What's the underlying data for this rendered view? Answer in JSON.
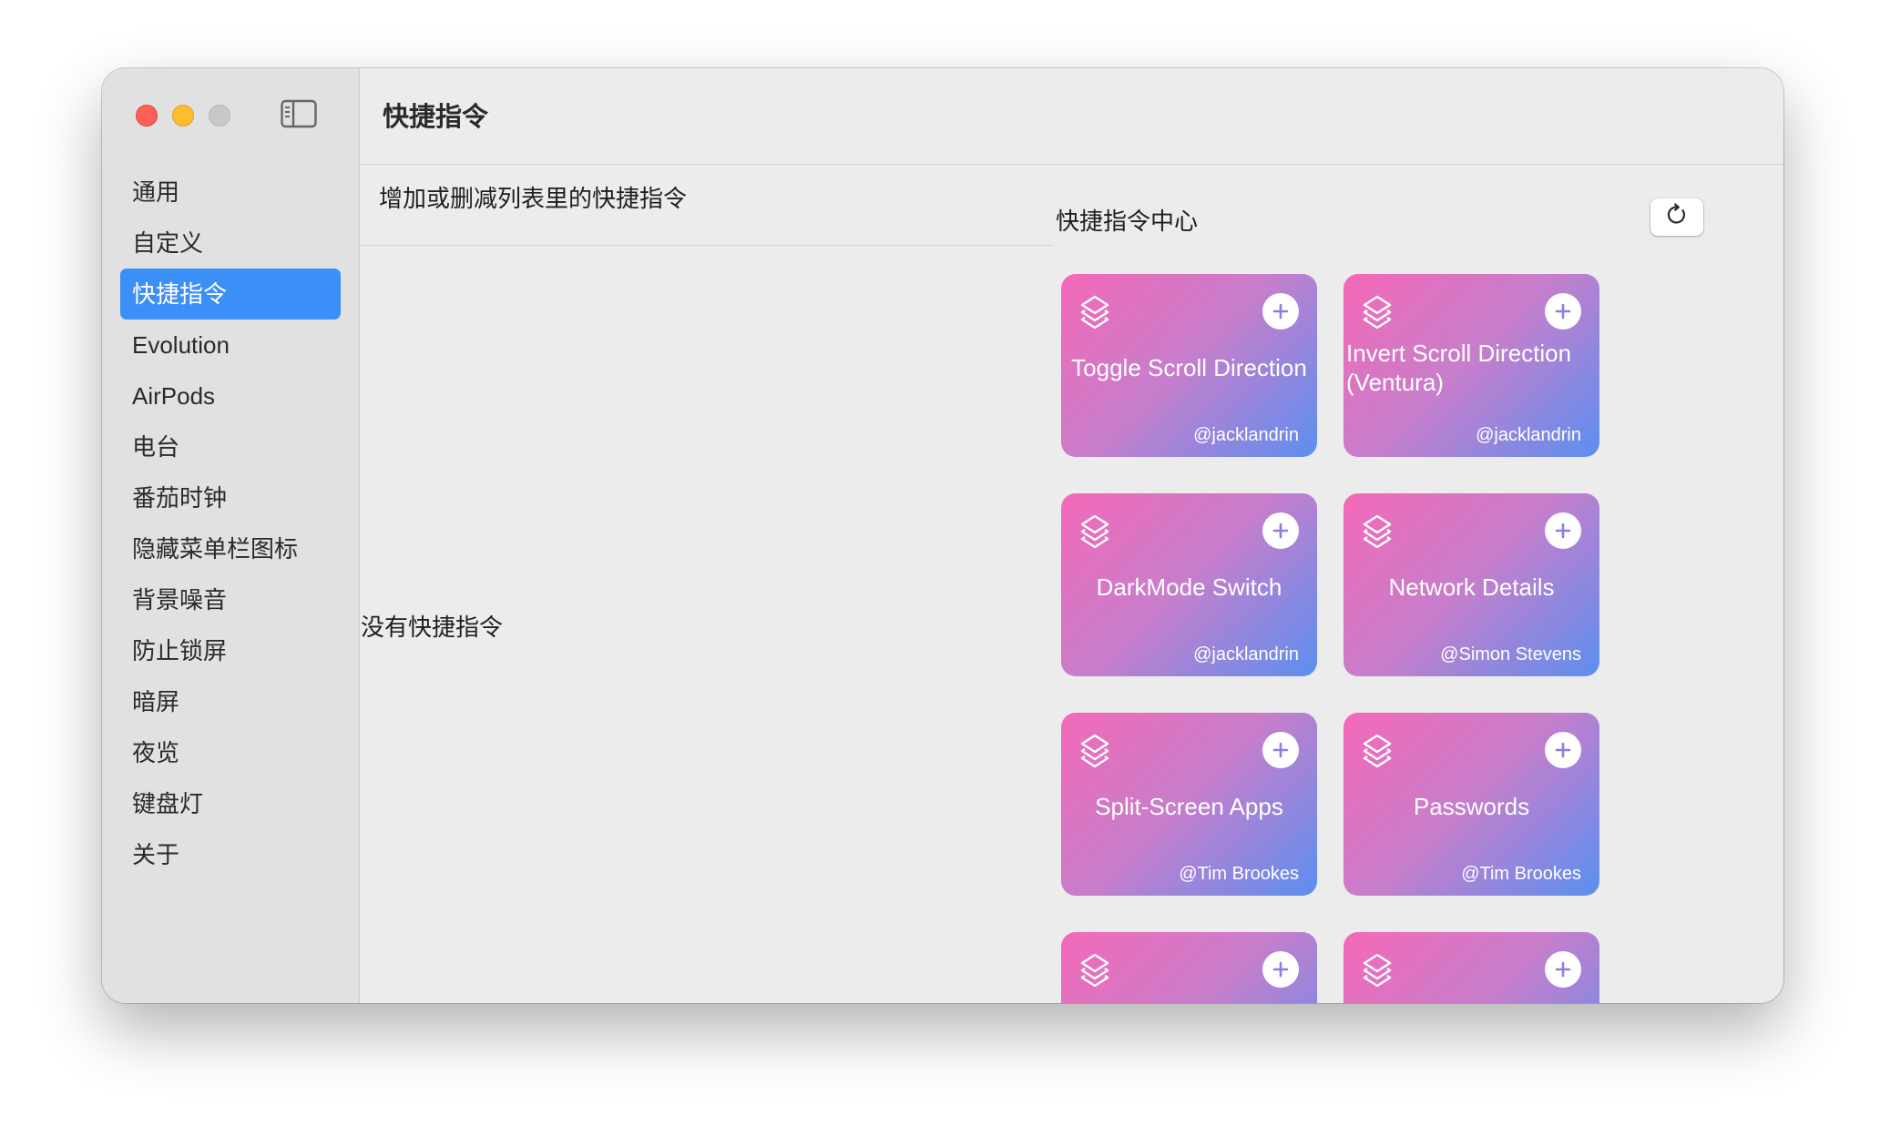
{
  "sidebar": {
    "items": [
      {
        "label": "通用"
      },
      {
        "label": "自定义"
      },
      {
        "label": "快捷指令",
        "active": true
      },
      {
        "label": "Evolution"
      },
      {
        "label": "AirPods"
      },
      {
        "label": "电台"
      },
      {
        "label": "番茄时钟"
      },
      {
        "label": "隐藏菜单栏图标"
      },
      {
        "label": "背景噪音"
      },
      {
        "label": "防止锁屏"
      },
      {
        "label": "暗屏"
      },
      {
        "label": "夜览"
      },
      {
        "label": "键盘灯"
      },
      {
        "label": "关于"
      }
    ]
  },
  "header": {
    "title": "快捷指令"
  },
  "list": {
    "header": "增加或删减列表里的快捷指令",
    "empty_text": "没有快捷指令"
  },
  "center": {
    "title": "快捷指令中心",
    "cards": [
      {
        "title": "Toggle Scroll Direction",
        "author": "@jacklandrin"
      },
      {
        "title": "Invert Scroll Direction (Ventura)",
        "author": "@jacklandrin"
      },
      {
        "title": "DarkMode Switch",
        "author": "@jacklandrin"
      },
      {
        "title": "Network Details",
        "author": "@Simon Stevens"
      },
      {
        "title": "Split-Screen Apps",
        "author": "@Tim Brookes"
      },
      {
        "title": "Passwords",
        "author": "@Tim Brookes"
      },
      {
        "title": "",
        "author": ""
      },
      {
        "title": "",
        "author": ""
      }
    ]
  },
  "icons": {
    "sidebar_toggle": "sidebar-toggle-icon",
    "refresh": "refresh-icon",
    "card_layers": "layers-icon",
    "card_add": "plus-icon"
  },
  "colors": {
    "accent": "#3b8ff6",
    "card_gradient_start": "#f469b8",
    "card_gradient_end": "#5b8ff0"
  }
}
